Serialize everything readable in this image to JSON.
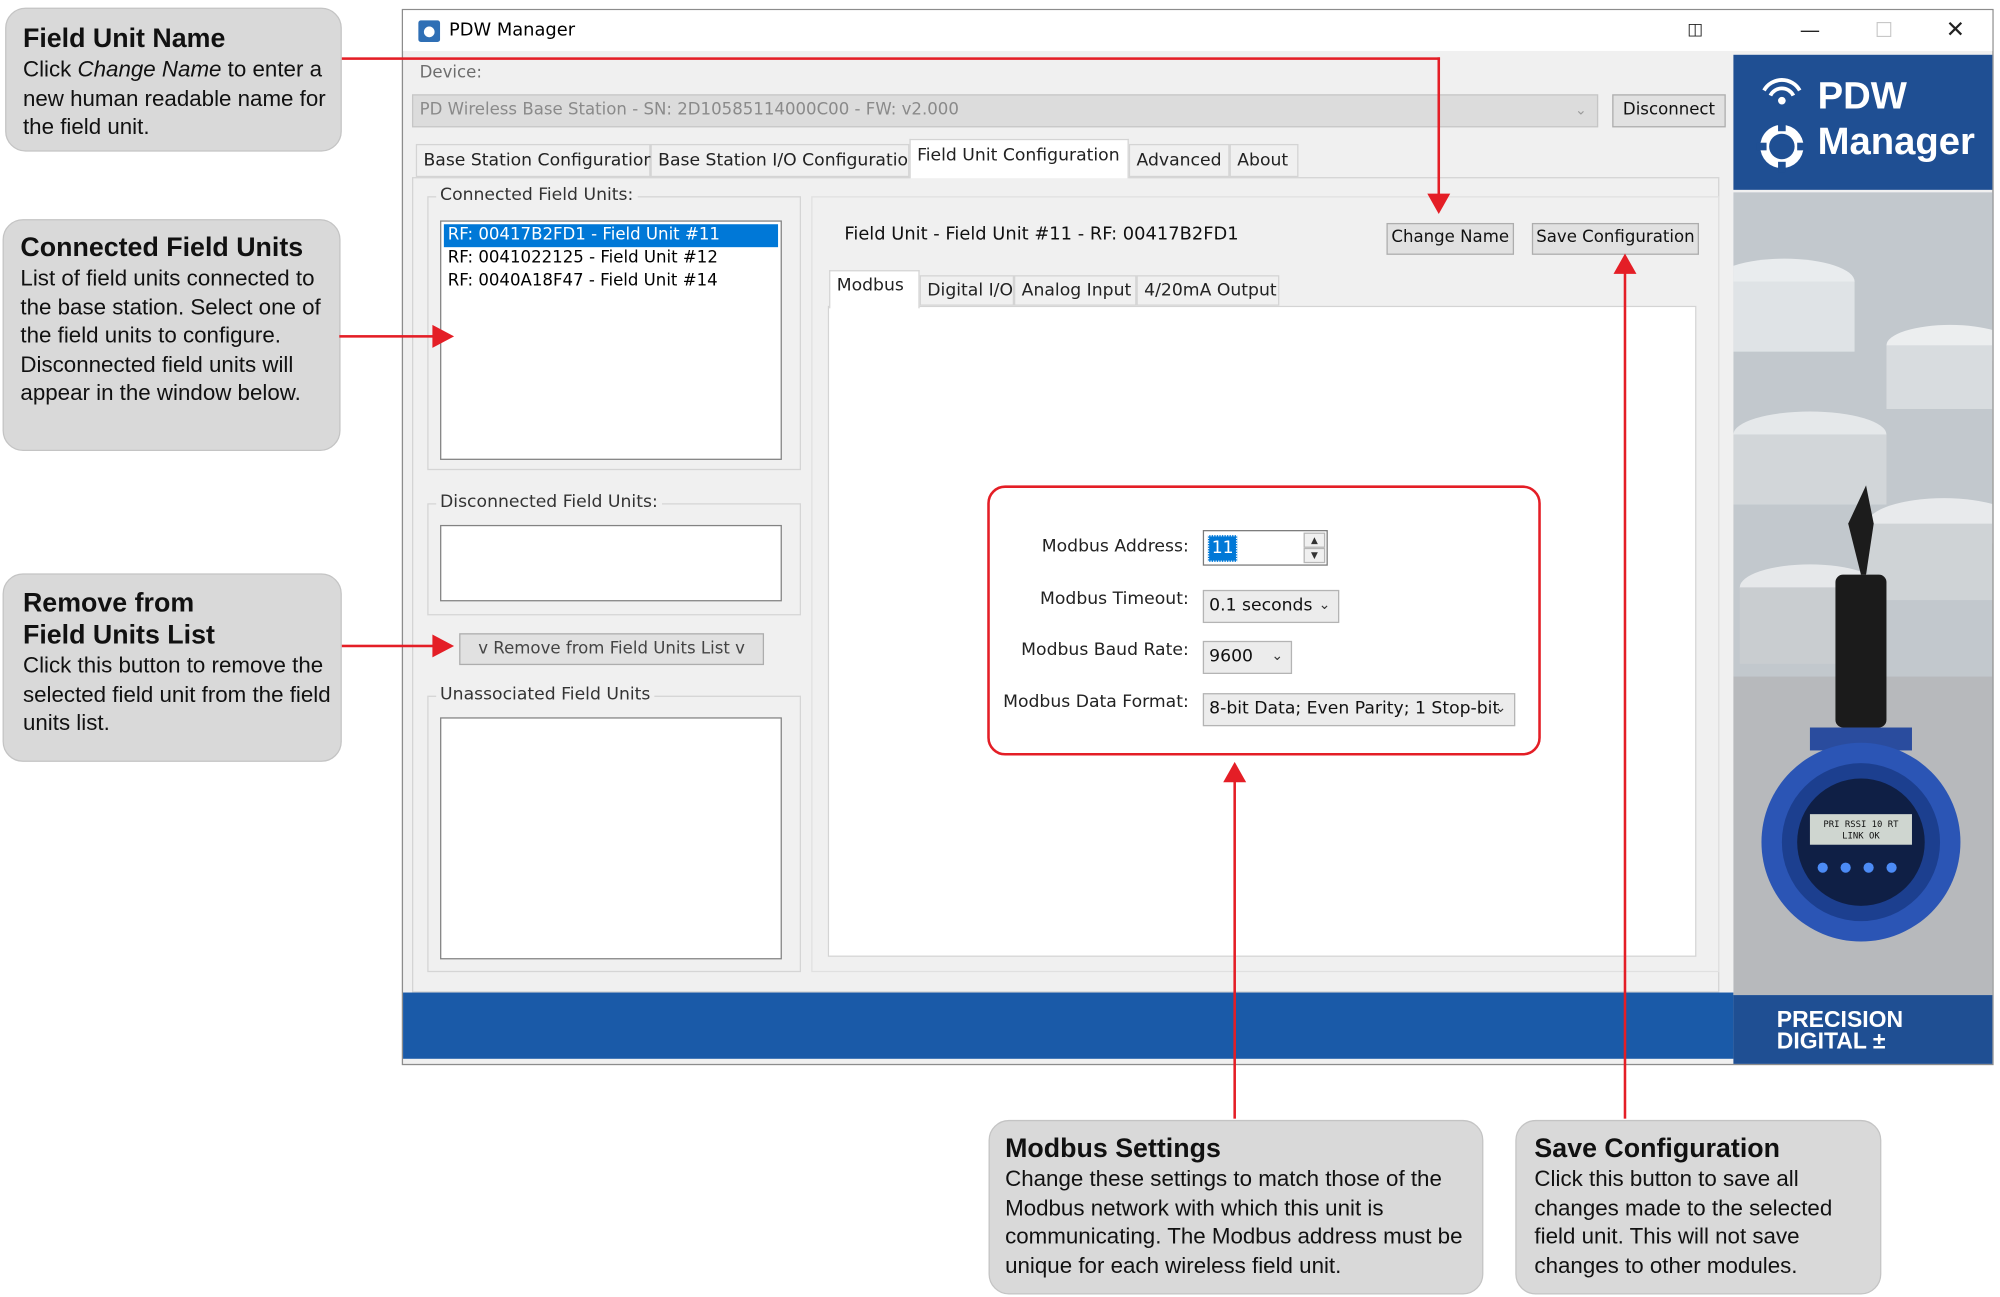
{
  "callouts": {
    "field_unit_name": {
      "title": "Field Unit Name",
      "body_pre": "Click ",
      "body_em": "Change Name",
      "body_post": " to enter a new human readable name for the field unit."
    },
    "connected_field_units": {
      "title": "Connected Field Units",
      "body": "List of field units connected to the base station. Select one of the field units to configure. Disconnected field units will appear in the window below."
    },
    "remove_from_list": {
      "title_line1": "Remove from",
      "title_line2": "Field Units List",
      "body": "Click this button to remove the selected field unit from the field units list."
    },
    "modbus_settings": {
      "title": "Modbus Settings",
      "body": "Change these settings to match those of the Modbus network with which this unit is communicating. The Modbus address must be unique for each wireless field unit."
    },
    "save_configuration": {
      "title": "Save Configuration",
      "body": "Click this button to save all changes made to the selected field unit. This will not save changes to other modules."
    }
  },
  "window": {
    "title": "PDW Manager",
    "icons": {
      "app": "app-icon",
      "snap": "snap-layout-icon",
      "minimize": "minimize-icon",
      "maximize": "maximize-icon",
      "close": "close-icon"
    }
  },
  "device": {
    "label": "Device:",
    "value": "PD Wireless Base Station - SN: 2D10585114000C00 - FW: v2.000",
    "disconnect_label": "Disconnect"
  },
  "main_tabs": [
    {
      "label": "Base Station Configuration"
    },
    {
      "label": "Base Station I/O Configuration"
    },
    {
      "label": "Field Unit Configuration"
    },
    {
      "label": "Advanced"
    },
    {
      "label": "About"
    }
  ],
  "connected": {
    "title": "Connected Field Units:",
    "items": [
      {
        "label": "RF: 00417B2FD1 - Field Unit #11"
      },
      {
        "label": "RF: 0041022125 - Field Unit #12"
      },
      {
        "label": "RF: 0040A18F47 - Field Unit #14"
      }
    ]
  },
  "disconnected": {
    "title": "Disconnected Field Units:"
  },
  "remove_button_label": "v Remove from Field Units List v",
  "unassociated": {
    "title": "Unassociated Field Units"
  },
  "field_unit_header": "Field Unit - Field Unit #11 - RF: 00417B2FD1",
  "change_name_label": "Change Name",
  "save_config_label": "Save Configuration",
  "inner_tabs": [
    {
      "label": "Modbus"
    },
    {
      "label": "Digital I/O"
    },
    {
      "label": "Analog Input"
    },
    {
      "label": "4/20mA Output"
    }
  ],
  "modbus": {
    "address_label": "Modbus Address:",
    "address_value": "11",
    "timeout_label": "Modbus Timeout:",
    "timeout_value": "0.1 seconds",
    "baud_label": "Modbus Baud Rate:",
    "baud_value": "9600",
    "format_label": "Modbus Data Format:",
    "format_value": "8-bit Data; Even Parity; 1 Stop-bit"
  },
  "brand": {
    "line1": "PDW",
    "line2": "Manager",
    "footer_line1": "PRECISION",
    "footer_line2": "DIGITAL",
    "device_display_line1": "PRI  RSSI 10  RT",
    "device_display_line2": "LINK OK"
  },
  "colors": {
    "accent_red": "#e41e26",
    "brand_blue": "#1f4f93",
    "footer_blue": "#1a5aa8",
    "selection_blue": "#0078d7"
  }
}
